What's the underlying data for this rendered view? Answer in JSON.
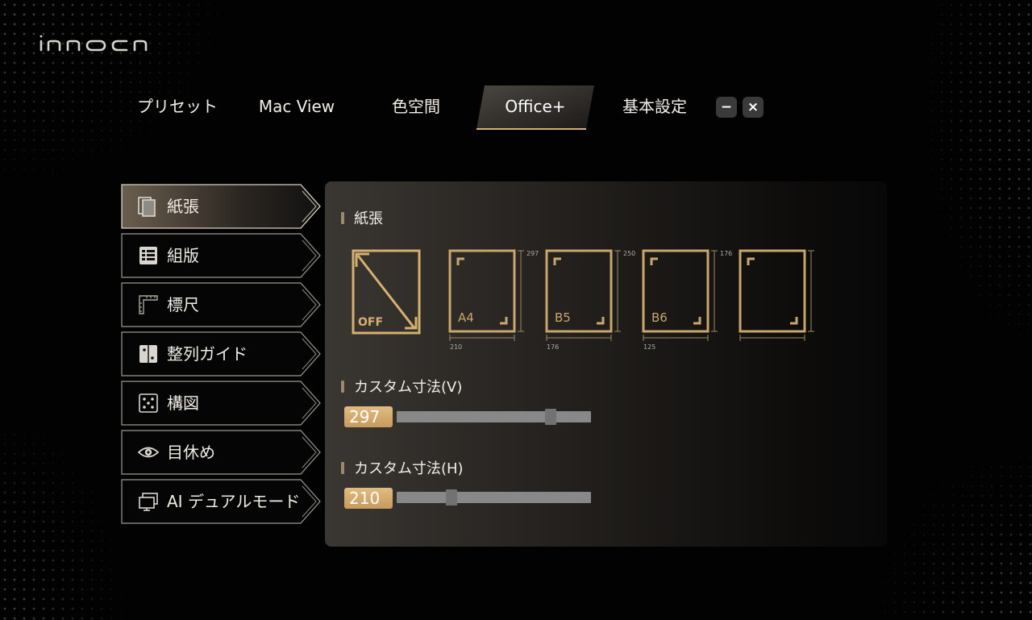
{
  "brand": {
    "logo_text": "innocn"
  },
  "tabs": [
    {
      "label": "プリセット",
      "active": false
    },
    {
      "label": "Mac View",
      "active": false
    },
    {
      "label": "色空間",
      "active": false
    },
    {
      "label": "Office+",
      "active": true
    },
    {
      "label": "基本設定",
      "active": false
    }
  ],
  "window_controls": {
    "minimize": "−",
    "close": "×"
  },
  "sidebar": {
    "items": [
      {
        "label": "紙張",
        "icon": "pages-icon",
        "active": true
      },
      {
        "label": "組版",
        "icon": "layout-icon",
        "active": false
      },
      {
        "label": "標尺",
        "icon": "ruler-icon",
        "active": false
      },
      {
        "label": "整列ガイド",
        "icon": "align-guide-icon",
        "active": false
      },
      {
        "label": "構図",
        "icon": "composition-icon",
        "active": false
      },
      {
        "label": "目休め",
        "icon": "eye-icon",
        "active": false
      },
      {
        "label": "AI デュアルモード",
        "icon": "dual-monitor-icon",
        "active": false
      }
    ]
  },
  "paper_section": {
    "title": "紙張",
    "options": [
      {
        "label": "OFF",
        "selected": true
      },
      {
        "label": "A4",
        "width_label": "210",
        "height_label": "297",
        "selected": false
      },
      {
        "label": "B5",
        "width_label": "176",
        "height_label": "250",
        "selected": false
      },
      {
        "label": "B6",
        "width_label": "125",
        "height_label": "176",
        "selected": false
      },
      {
        "label": "",
        "selected": false
      }
    ]
  },
  "custom_v": {
    "title": "カスタム寸法(V)",
    "value": "297",
    "level": 0.81
  },
  "custom_h": {
    "title": "カスタム寸法(H)",
    "value": "210",
    "level": 0.27
  },
  "colors": {
    "accent": "#d6b070",
    "gold_line": "#c9a66b",
    "bg": "#020202"
  }
}
